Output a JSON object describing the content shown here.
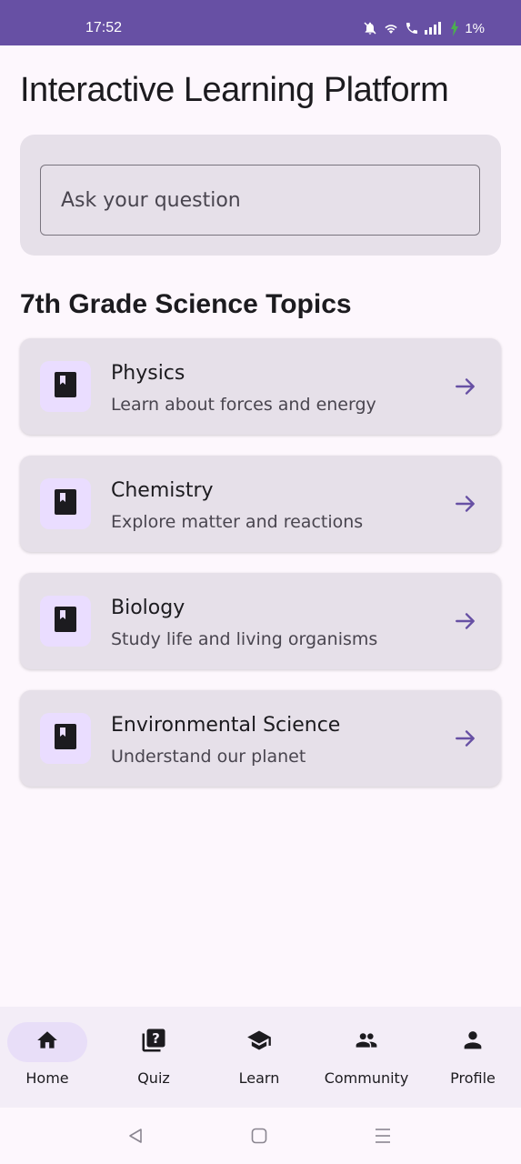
{
  "status_bar": {
    "time": "17:52",
    "battery": "1%",
    "icons": [
      "bell-off-icon",
      "wifi-icon",
      "wifi-call-icon",
      "signal-icon",
      "battery-charging-icon"
    ]
  },
  "page": {
    "title": "Interactive Learning Platform"
  },
  "search": {
    "placeholder": "Ask your question"
  },
  "topics_section": {
    "title": "7th Grade Science Topics",
    "topics": [
      {
        "title": "Physics",
        "description": "Learn about forces and energy",
        "icon": "book-icon"
      },
      {
        "title": "Chemistry",
        "description": "Explore matter and reactions",
        "icon": "book-icon"
      },
      {
        "title": "Biology",
        "description": "Study life and living organisms",
        "icon": "book-icon"
      },
      {
        "title": "Environmental Science",
        "description": "Understand our planet",
        "icon": "book-icon"
      }
    ]
  },
  "bottom_nav": {
    "items": [
      {
        "label": "Home",
        "icon": "home-icon",
        "active": true
      },
      {
        "label": "Quiz",
        "icon": "quiz-icon",
        "active": false
      },
      {
        "label": "Learn",
        "icon": "school-icon",
        "active": false
      },
      {
        "label": "Community",
        "icon": "people-icon",
        "active": false
      },
      {
        "label": "Profile",
        "icon": "person-icon",
        "active": false
      }
    ]
  },
  "colors": {
    "primary": "#6750a4",
    "surface_variant": "#e6e0e9",
    "background": "#fdf7fd",
    "nav_background": "#f3edf7",
    "active_indicator": "#e8def8"
  }
}
